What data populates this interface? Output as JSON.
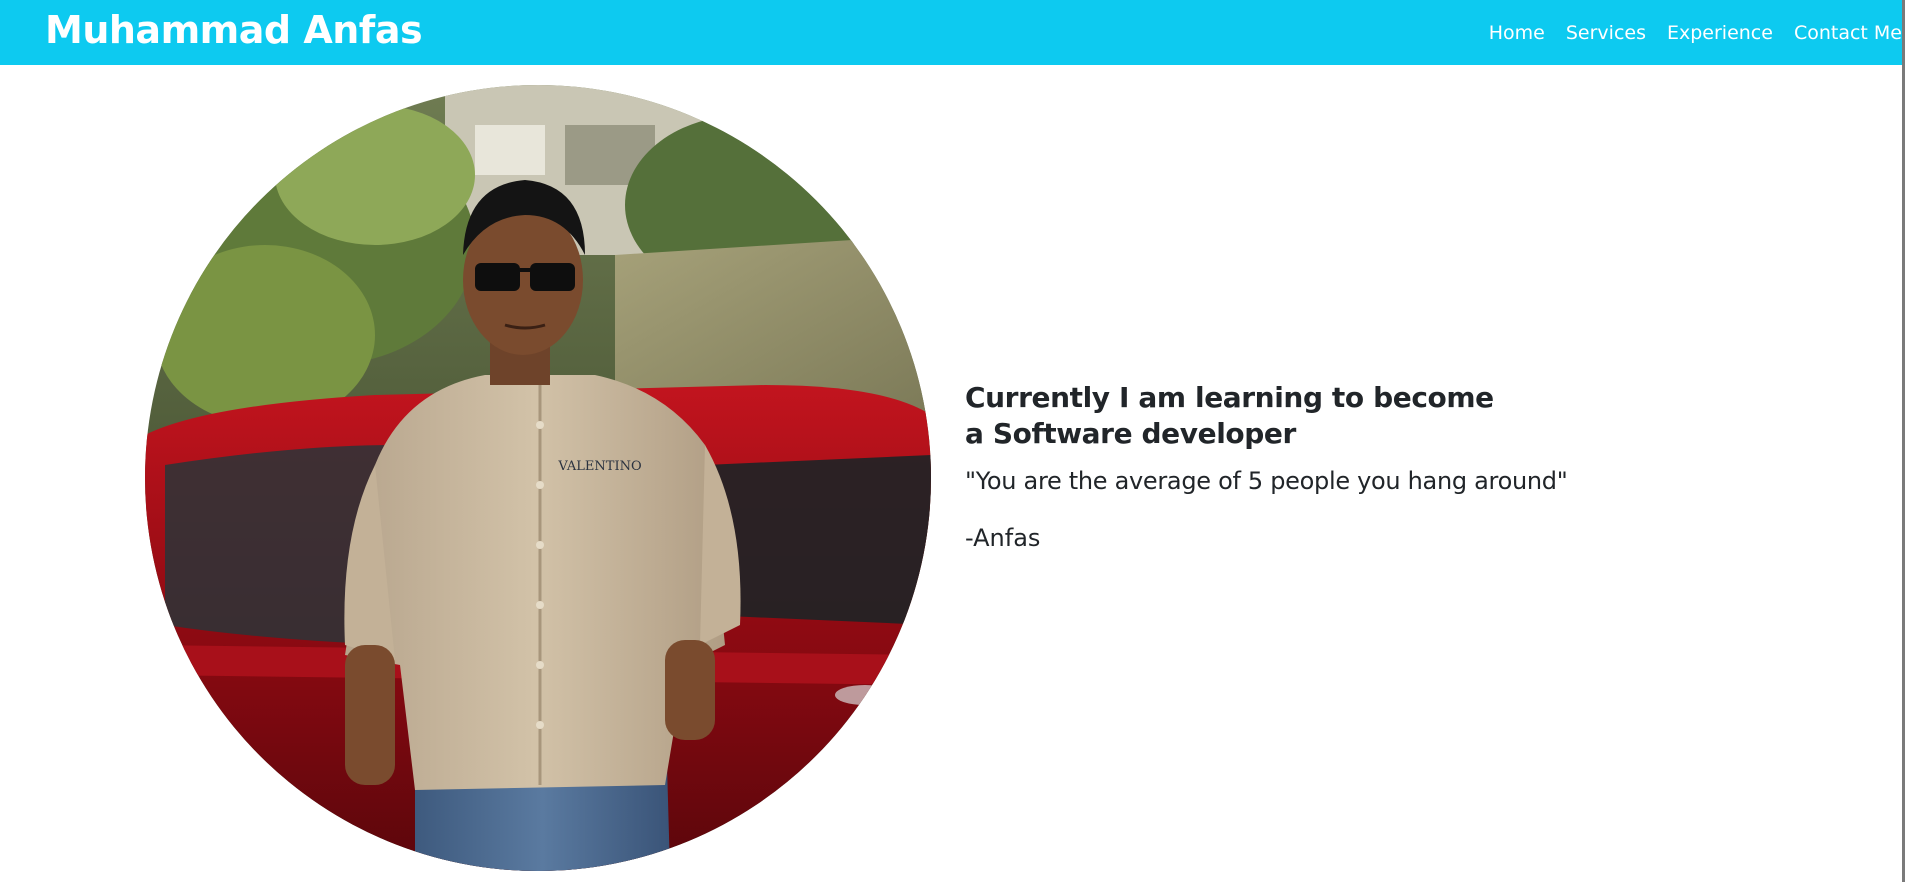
{
  "navbar": {
    "brand": "Muhammad Anfas",
    "links": [
      {
        "label": "Home"
      },
      {
        "label": "Services"
      },
      {
        "label": "Experience"
      },
      {
        "label": "Contact Me"
      }
    ],
    "background_color": "#0dcaf0"
  },
  "hero": {
    "heading_line1": "Currently I am learning to become",
    "heading_line2": "a Software developer",
    "quote": "\"You are the average of 5 people you hang around\"",
    "author": "-Anfas",
    "shirt_logo_text": "VALENTINO"
  }
}
